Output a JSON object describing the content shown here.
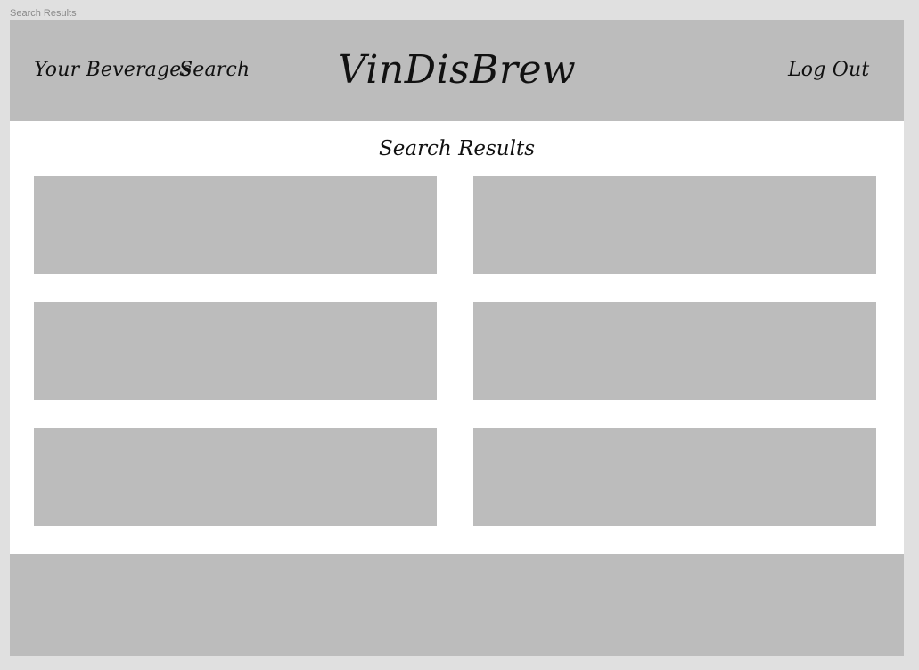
{
  "frame_label": "Search Results",
  "header": {
    "nav_left": [
      {
        "label": "Your Beverages"
      },
      {
        "label": "Search"
      }
    ],
    "logo": "VinDisBrew",
    "logout_label": "Log Out"
  },
  "main": {
    "title": "Search Results",
    "result_count": 6
  },
  "colors": {
    "page_bg": "#e0e0e0",
    "placeholder_gray": "#bcbcbc",
    "content_bg": "#ffffff",
    "text": "#111111"
  }
}
